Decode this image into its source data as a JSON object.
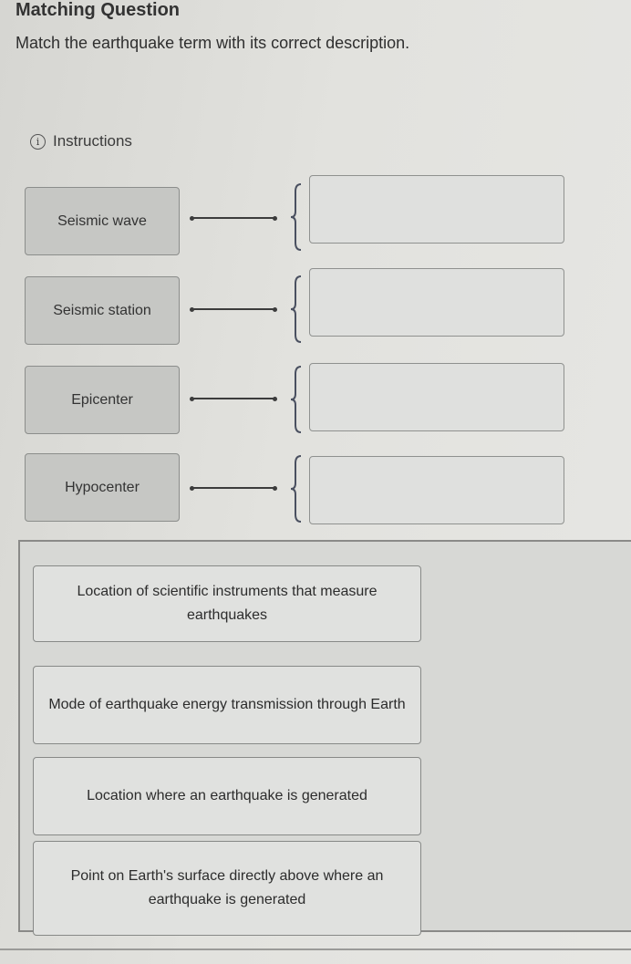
{
  "header": {
    "title": "Matching Question",
    "prompt": "Match the earthquake term with its correct description.",
    "instructions_label": "Instructions",
    "instructions_icon": "info-icon"
  },
  "terms": [
    {
      "label": "Seismic wave",
      "drop_value": ""
    },
    {
      "label": "Seismic station",
      "drop_value": ""
    },
    {
      "label": "Epicenter",
      "drop_value": ""
    },
    {
      "label": "Hypocenter",
      "drop_value": ""
    }
  ],
  "answer_bank": [
    {
      "text": "Location of scientific instruments that measure earthquakes"
    },
    {
      "text": "Mode of earthquake energy transmission through Earth"
    },
    {
      "text": "Location where an earthquake is generated"
    },
    {
      "text": "Point on Earth's surface directly above where an earthquake is generated"
    }
  ]
}
